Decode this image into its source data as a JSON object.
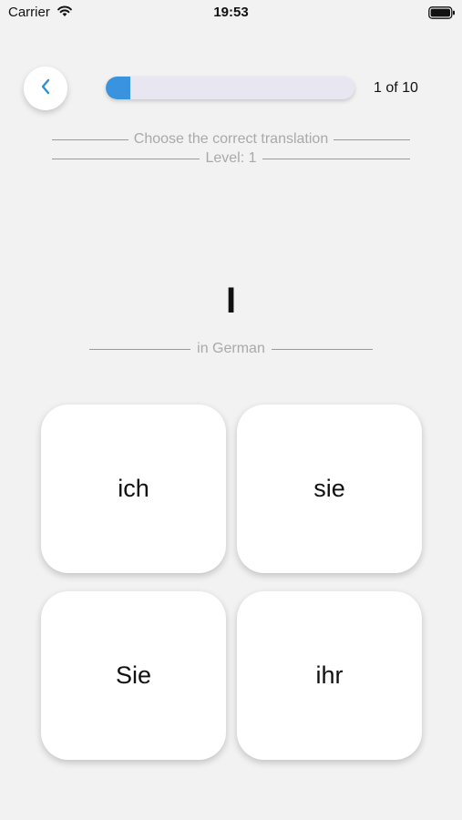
{
  "status_bar": {
    "carrier": "Carrier",
    "time": "19:53",
    "icons": [
      "wifi-icon",
      "battery-icon"
    ]
  },
  "header": {
    "back_icon": "chevron-left-icon",
    "progress_fraction": 0.1,
    "progress_text": "1 of 10",
    "accent_color": "#3a93df"
  },
  "instructions": {
    "prompt": "Choose the correct translation",
    "level": "Level: 1"
  },
  "question": {
    "word": "I",
    "language_hint": "in German"
  },
  "answers": [
    "ich",
    "sie",
    "Sie",
    "ihr"
  ]
}
